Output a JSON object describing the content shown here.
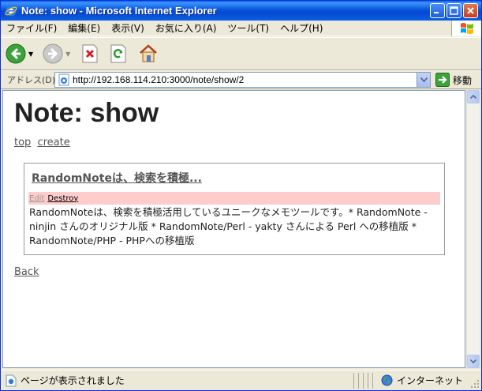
{
  "window": {
    "title": "Note: show - Microsoft Internet Explorer"
  },
  "menu": {
    "items": [
      "ファイル(F)",
      "編集(E)",
      "表示(V)",
      "お気に入り(A)",
      "ツール(T)",
      "ヘルプ(H)"
    ]
  },
  "address": {
    "label": "アドレス(D)",
    "url": "http://192.168.114.210:3000/note/show/2",
    "go_label": "移動"
  },
  "page": {
    "heading": "Note: show",
    "nav": {
      "top": "top",
      "create": "create"
    },
    "note": {
      "title": "RandomNoteは、検索を積極...",
      "edit": "Edit",
      "destroy": "Destroy",
      "body": "RandomNoteは、検索を積極活用しているユニークなメモツールです。* RandomNote - ninjin さんのオリジナル版 * RandomNote/Perl - yakty さんによる Perl への移植版 * RandomNote/PHP - PHPへの移植版"
    },
    "back": "Back"
  },
  "status": {
    "text": "ページが表示されました",
    "zone": "インターネット"
  },
  "colors": {
    "title_bar": "#0855dd",
    "action_bar": "#ffcccc",
    "link": "#555555"
  }
}
